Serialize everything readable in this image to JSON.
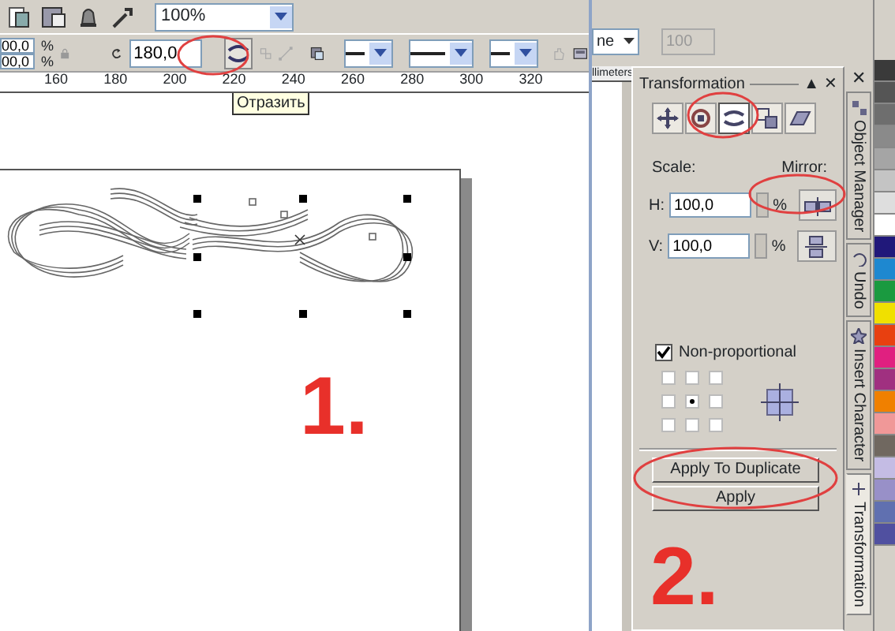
{
  "toolbar": {
    "zoom_level": "100%"
  },
  "property_bar": {
    "size_fields": [
      "00,0",
      "00,0"
    ],
    "units": [
      "%",
      "%"
    ],
    "rotation": "180,0"
  },
  "tooltip": "Отразить",
  "ruler": {
    "labels": [
      "160",
      "180",
      "200",
      "220",
      "240",
      "260",
      "280",
      "300",
      "320"
    ]
  },
  "docker_toolbar": {
    "style_combo": "ne",
    "outline_field": "100",
    "units_label": "llimeters"
  },
  "docker": {
    "title": "Transformation",
    "header_buttons": [
      "▲",
      "✕"
    ],
    "tabs": [
      {
        "kind": "position",
        "selected": false
      },
      {
        "kind": "rotate",
        "selected": false
      },
      {
        "kind": "scale",
        "selected": true
      },
      {
        "kind": "size",
        "selected": false
      },
      {
        "kind": "skew",
        "selected": false
      }
    ],
    "scale_label": "Scale:",
    "mirror_label": "Mirror:",
    "fields": [
      {
        "label": "H:",
        "value": "100,0",
        "unit": "%",
        "kind": "horizontal"
      },
      {
        "label": "V:",
        "value": "100,0",
        "unit": "%",
        "kind": "vertical"
      }
    ],
    "non_proportional": {
      "label": "Non-proportional",
      "checked": true
    },
    "anchor_points": [
      {
        "selected": false
      },
      {
        "selected": false
      },
      {
        "selected": false
      },
      {
        "selected": false
      },
      {
        "selected": true
      },
      {
        "selected": false
      },
      {
        "selected": false
      },
      {
        "selected": false
      },
      {
        "selected": false
      }
    ],
    "buttons": [
      "Apply To Duplicate",
      "Apply"
    ]
  },
  "side_tabs": {
    "close": "✕",
    "tabs": [
      {
        "label": "Object Manager",
        "selected": false
      },
      {
        "label": "Undo",
        "selected": false
      },
      {
        "label": "Insert Character",
        "selected": false
      },
      {
        "label": "Transformation",
        "selected": true
      }
    ]
  },
  "palette": [
    {
      "color": "#3a3a3a"
    },
    {
      "color": "#555555"
    },
    {
      "color": "#6e6e6e"
    },
    {
      "color": "#8a8a8a"
    },
    {
      "color": "#a5a5a5"
    },
    {
      "color": "#c4c4c4"
    },
    {
      "color": "#dedede"
    },
    {
      "color": "#ffffff"
    },
    {
      "color": "#20187a"
    },
    {
      "color": "#1e88d0"
    },
    {
      "color": "#1a9a40"
    },
    {
      "color": "#f0e000"
    },
    {
      "color": "#e84010"
    },
    {
      "color": "#e02080"
    },
    {
      "color": "#a03080"
    },
    {
      "color": "#f08000"
    },
    {
      "color": "#f09898"
    },
    {
      "color": "#706860"
    },
    {
      "color": "#c4bce4"
    },
    {
      "color": "#9890c8"
    },
    {
      "color": "#6070b0"
    },
    {
      "color": "#5050a0"
    }
  ],
  "annotations": {
    "steps": [
      "1.",
      "2."
    ]
  }
}
